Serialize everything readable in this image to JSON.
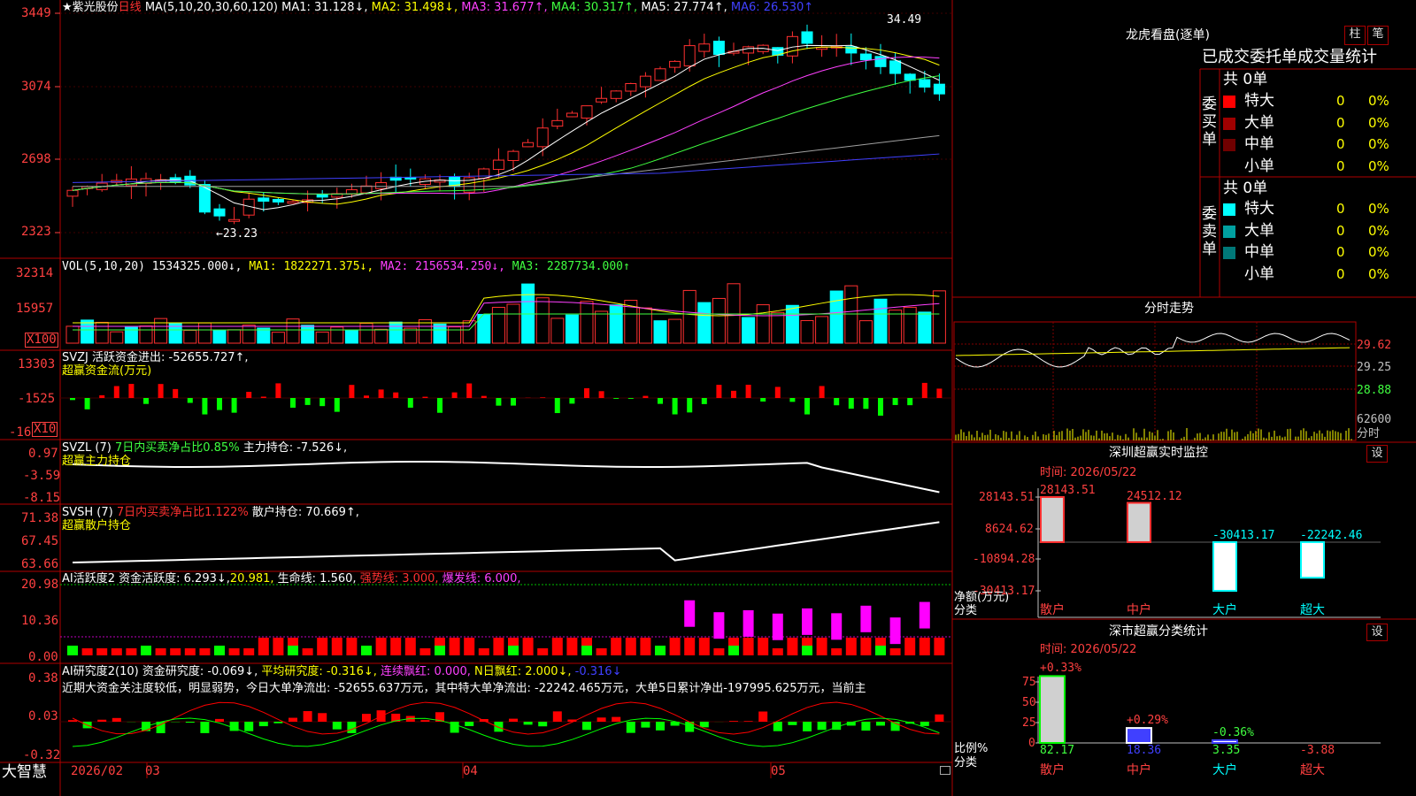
{
  "price_panel": {
    "star_title": "★紫光股份",
    "period": "日线",
    "ma_params": "MA(5,10,20,30,60,120)",
    "ma1": "MA1: 31.128↓,",
    "ma2": "MA2: 31.498↓,",
    "ma3": "MA3: 31.677↑,",
    "ma4": "MA4: 30.317↑,",
    "ma5": "MA5: 27.774↑,",
    "ma6": "MA6: 26.530↑",
    "y_ticks": [
      "3449",
      "3074",
      "2698",
      "2323"
    ],
    "high_label": "34.49",
    "low_label": "←23.23"
  },
  "vol_panel": {
    "title": "VOL(5,10,20)",
    "vol": "1534325.000↓,",
    "ma1": "MA1: 1822271.375↓,",
    "ma2": "MA2: 2156534.250↓,",
    "ma3": "MA3: 2287734.000↑",
    "y_ticks": [
      "32314",
      "15957"
    ],
    "unit": "X100"
  },
  "svzj_panel": {
    "title": "SVZJ  活跃资金进出: -52655.727↑,",
    "subtitle": "超赢资金流(万元)",
    "y_ticks": [
      "13303",
      "-1525",
      "-16"
    ],
    "unit": "X10"
  },
  "svzl_panel": {
    "title_a": "SVZL (7)",
    "title_b": "7日内买卖净占比0.85%",
    "title_c": "主力持仓: -7.526↓,",
    "subtitle": "超赢主力持仓",
    "y_ticks": [
      "0.97",
      "-3.59",
      "-8.15"
    ]
  },
  "svsh_panel": {
    "title_a": "SVSH (7)",
    "title_b": "7日内买卖净占比1.122%",
    "title_c": "散户持仓: 70.669↑,",
    "subtitle": "超赢散户持仓",
    "y_ticks": [
      "71.38",
      "67.45",
      "63.66"
    ]
  },
  "ai_active_panel": {
    "title_a": "AI活跃度2",
    "title_b": "资金活跃度: 6.293↓,",
    "title_c": "20.981,",
    "title_d": "生命线: 1.560,",
    "title_e": "强势线: 3.000,",
    "title_f": "爆发线: 6.000,",
    "y_ticks": [
      "20.98",
      "10.36",
      "0.00"
    ]
  },
  "ai_research_panel": {
    "title_a": "AI研究度2(10)",
    "title_b": "资金研究度: -0.069↓,",
    "title_c": "平均研究度: -0.316↓,",
    "title_d": "连续飘红: 0.000,",
    "title_e": "N日飘红: 2.000↓,",
    "title_f": "-0.316↓",
    "comment": "近期大资金关注度较低，明显弱势，今日大单净流出: -52655.637万元，其中特大单净流出: -22242.465万元，大单5日累计净出-197995.625万元，当前主",
    "y_ticks": [
      "0.38",
      "0.03",
      "-0.32"
    ]
  },
  "bottom_axis": {
    "brand": "大智慧",
    "labels": [
      "2026/02",
      "03",
      "04",
      "05"
    ]
  },
  "longhu": {
    "title": "龙虎看盘(逐单)",
    "btn_bar": "柱",
    "btn_pen": "笔",
    "header": "已成交委托单成交量统计",
    "buy_label": "委买单",
    "sell_label": "委卖单",
    "buy_count": "共 0单",
    "sell_count": "共 0单",
    "buy_rows": [
      {
        "name": "特大",
        "num": "0",
        "pct": "0%",
        "color": "#ff0000"
      },
      {
        "name": "大单",
        "num": "0",
        "pct": "0%",
        "color": "#a00000"
      },
      {
        "name": "中单",
        "num": "0",
        "pct": "0%",
        "color": "#700000"
      },
      {
        "name": "小单",
        "num": "0",
        "pct": "0%",
        "color": ""
      }
    ],
    "sell_rows": [
      {
        "name": "特大",
        "num": "0",
        "pct": "0%",
        "color": "#00ffff"
      },
      {
        "name": "大单",
        "num": "0",
        "pct": "0%",
        "color": "#00a0a0"
      },
      {
        "name": "中单",
        "num": "0",
        "pct": "0%",
        "color": "#007878"
      },
      {
        "name": "小单",
        "num": "0",
        "pct": "0%",
        "color": ""
      }
    ]
  },
  "intraday": {
    "title": "分时走势",
    "y_ticks": [
      "29.62",
      "29.25",
      "28.88"
    ],
    "vol_tick": "62600",
    "vol_label": "分时"
  },
  "monitor": {
    "title": "深圳超赢实时监控",
    "set_btn": "设",
    "time": "时间: 2026/05/22",
    "y_ticks": [
      "28143.51",
      "8624.62",
      "-10894.28",
      "-30413.17"
    ],
    "y_name": "净额(万元)",
    "x_name": "分类",
    "values": [
      {
        "label": "散户",
        "value": 28143.51,
        "text": "28143.51"
      },
      {
        "label": "中户",
        "value": 24512.12,
        "text": "24512.12"
      },
      {
        "label": "大户",
        "value": -30413.17,
        "text": "-30413.17"
      },
      {
        "label": "超大",
        "value": -22242.46,
        "text": "-22242.46"
      }
    ]
  },
  "classify": {
    "title": "深市超赢分类统计",
    "set_btn": "设",
    "time": "时间: 2026/05/22",
    "y_ticks": [
      "75",
      "50",
      "25",
      "0"
    ],
    "y_name": "比例%",
    "x_name": "分类",
    "values": [
      {
        "label": "散户",
        "ratio": 82.17,
        "ratio_text": "82.17",
        "change": "+0.33%"
      },
      {
        "label": "中户",
        "ratio": 18.36,
        "ratio_text": "18.36",
        "change": "+0.29%"
      },
      {
        "label": "大户",
        "ratio": 3.35,
        "ratio_text": "3.35",
        "change": "-0.36%"
      },
      {
        "label": "超大",
        "ratio": -3.88,
        "ratio_text": "-3.88",
        "change": ""
      }
    ]
  },
  "colors": {
    "up": "#ff3030",
    "down": "#00ffff",
    "grid": "#b00000",
    "axis_text": "#ff4040"
  }
}
